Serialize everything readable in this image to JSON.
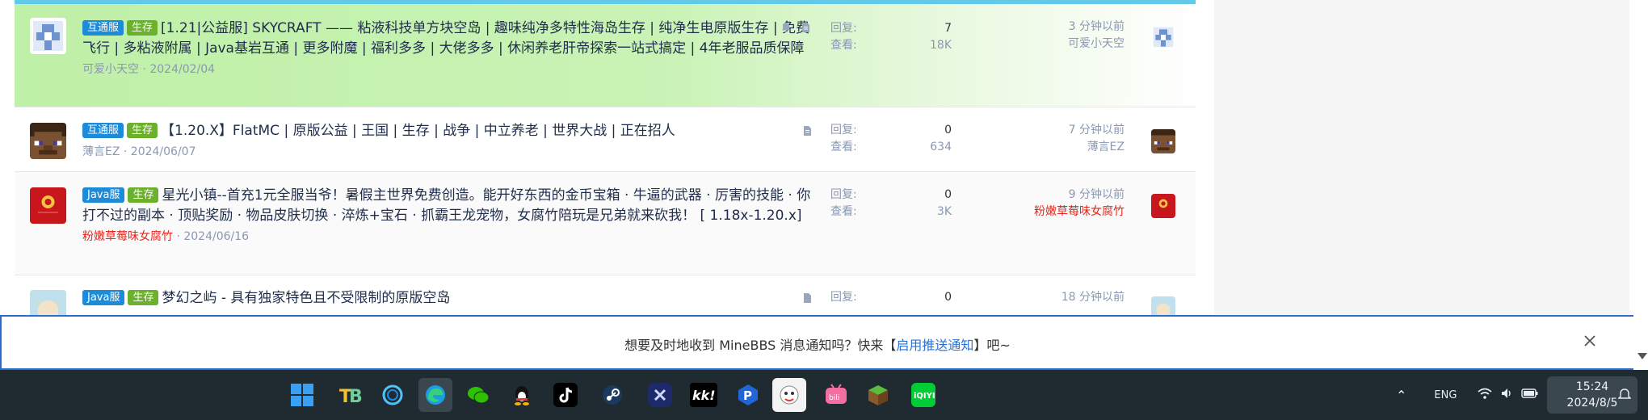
{
  "threads": [
    {
      "tags": [
        "互通服",
        "生存"
      ],
      "title": "[1.21|公益服] SKYCRAFT —— 粘液科技单方块空岛 | 趣味纯净多特性海岛生存 | 纯净生电原版生存 | 免费飞行 | 多粘液附属 | Java基岩互通 | 更多附魔 | 福利多多 | 大佬多多 | 休闲养老肝帝探索一站式搞定 | 4年老服品质保障",
      "author": "可爱小天空",
      "date": "2024/02/04",
      "replies_label": "回复:",
      "replies": "7",
      "views_label": "查看:",
      "views": "18K",
      "last_time": "3 分钟以前",
      "last_user": "可爱小天空"
    },
    {
      "tags": [
        "互通服",
        "生存"
      ],
      "title": "【1.20.X】FlatMC | 原版公益 | 王国 | 生存 | 战争 | 中立养老 | 世界大战 | 正在招人",
      "author": "薄言EZ",
      "date": "2024/06/07",
      "replies_label": "回复:",
      "replies": "0",
      "views_label": "查看:",
      "views": "634",
      "last_time": "7 分钟以前",
      "last_user": "薄言EZ"
    },
    {
      "tags": [
        "Java服",
        "生存"
      ],
      "title": "星光小镇--首充1元全服当爷！暑假主世界免费创造。能开好东西的金币宝箱 · 牛逼的武器 · 厉害的技能 · 你打不过的副本 · 顶贴奖励 · 物品皮肤切换 · 淬炼+宝石 · 抓霸王龙宠物，女腐竹陪玩是兄弟就来砍我！ [ 1.18x-1.20.x]",
      "author": "粉嫩草莓味女腐竹",
      "date": "2024/06/16",
      "replies_label": "回复:",
      "replies": "0",
      "views_label": "查看:",
      "views": "3K",
      "last_time": "9 分钟以前",
      "last_user": "粉嫩草莓味女腐竹"
    },
    {
      "tags": [
        "Java服",
        "生存"
      ],
      "title": "梦幻之屿 - 具有独家特色且不受限制的原版空岛",
      "replies_label": "回复:",
      "replies": "0",
      "last_time": "18 分钟以前"
    }
  ],
  "notification": {
    "before": "想要及时地收到 MineBBS 消息通知吗？快来【",
    "link": "启用推送通知",
    "after": "】吧~"
  },
  "taskbar": {
    "lang": "ENG",
    "time": "15:24",
    "date": "2024/8/5",
    "apps": [
      "windows-start-icon",
      "tb-app-icon",
      "cortana-ring-icon",
      "edge-browser-icon",
      "wechat-icon",
      "qq-icon",
      "tiktok-icon",
      "steam-icon",
      "close-x-app-icon",
      "kk-app-icon",
      "p-app-icon",
      "minebbs-app-icon",
      "bilibili-icon",
      "minecraft-icon",
      "iqiyi-icon"
    ]
  },
  "colors": {
    "accent_blue": "#2c6bd0",
    "tag_blue": "#1d8bd8",
    "tag_green": "#6bb12c",
    "sticky_green": "#bff0a7",
    "red_user": "#e8251b",
    "taskbar": "#1f2a31"
  }
}
